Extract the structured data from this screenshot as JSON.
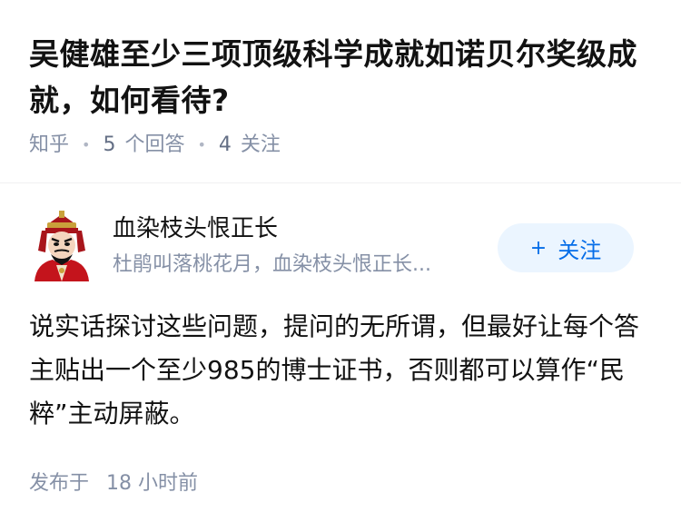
{
  "question": {
    "title": "吴健雄至少三项顶级科学成就如诺贝尔奖级成就，如何看待?",
    "source": "知乎",
    "answer_count": "5",
    "answer_label": "个回答",
    "follow_count": "4",
    "follow_label": "关注"
  },
  "answer": {
    "author_name": "血染枝头恨正长",
    "author_bio": "杜鹃叫落桃花月，血染枝头恨正长...",
    "follow_button": "关注",
    "content": "说实话探讨这些问题，提问的无所谓，但最好让每个答主贴出一个至少985的博士证书，否则都可以算作“民粹”主动屏蔽。",
    "published_label": "发布于",
    "published_time": "18 小时前"
  },
  "colors": {
    "brand_blue": "#056de8",
    "follow_bg": "#ebf5ff",
    "meta_gray": "#8590a6",
    "title_black": "#121212"
  },
  "icons": {
    "avatar": "opera-mask-avatar",
    "follow": "plus-icon"
  }
}
